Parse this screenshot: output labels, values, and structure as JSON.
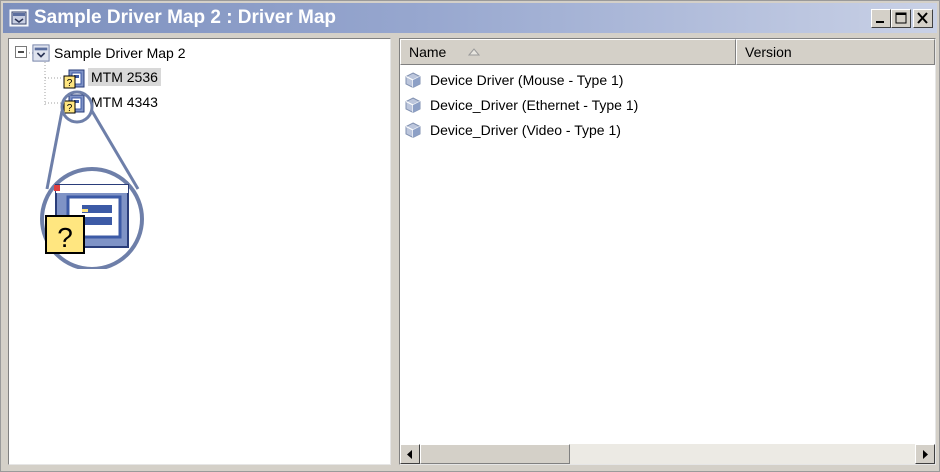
{
  "window": {
    "title": "Sample Driver Map 2 : Driver Map",
    "controls": [
      "minimize-icon",
      "maximize-icon",
      "close-icon"
    ]
  },
  "tree": {
    "root": {
      "label": "Sample Driver Map 2",
      "icon": "driver-map-icon",
      "expander": "collapse-icon"
    },
    "children": [
      {
        "label": "MTM 2536",
        "icon": "unknown-machine-icon",
        "selected": true
      },
      {
        "label": "MTM 4343",
        "icon": "unknown-machine-icon",
        "selected": false
      }
    ],
    "callout": {
      "icon": "unknown-machine-icon",
      "glyph": "?"
    }
  },
  "list": {
    "columns": [
      {
        "label": "Name",
        "sort": "ascending"
      },
      {
        "label": "Version"
      }
    ],
    "rows": [
      {
        "name": "Device Driver (Mouse - Type 1)",
        "icon": "driver-package-icon"
      },
      {
        "name": "Device_Driver (Ethernet - Type 1)",
        "icon": "driver-package-icon"
      },
      {
        "name": "Device_Driver (Video - Type 1)",
        "icon": "driver-package-icon"
      }
    ]
  },
  "colors": {
    "titlebar_start": "#7c8fbd",
    "titlebar_end": "#c9d1e6",
    "chrome": "#d4d0c8",
    "icon_yellow": "#ffe680",
    "icon_blue": "#3c5aa6",
    "callout_ring": "#6e7fa9"
  }
}
